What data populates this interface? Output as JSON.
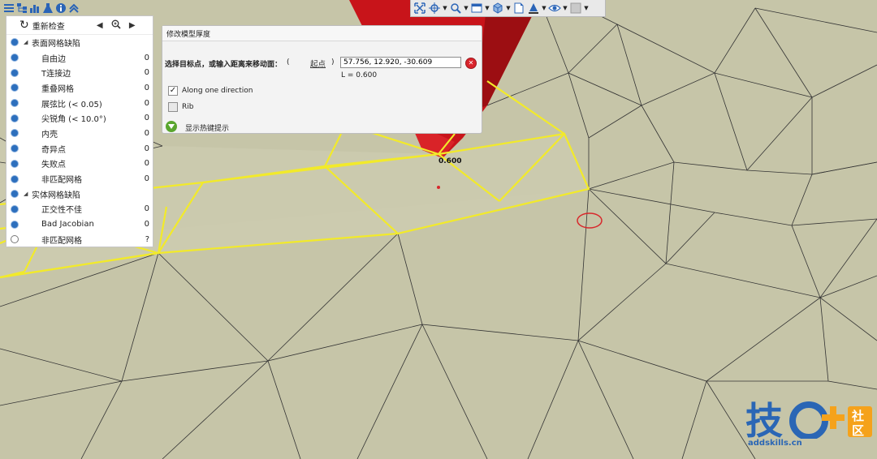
{
  "left_toolbar": {
    "icons": [
      "tree-icon",
      "hierarchy-icon",
      "chart-icon",
      "flask-icon",
      "info-icon",
      "collapse-icon"
    ]
  },
  "right_toolbar": {
    "icons": [
      "fit-view-icon",
      "pick-point-icon",
      "zoom-icon",
      "window-icon",
      "cube-view-icon",
      "page-icon",
      "fill-icon",
      "eye-icon",
      "display-icon"
    ]
  },
  "panel": {
    "recheck_label": "重新检查",
    "surface_category": "表面网格缺陷",
    "surface_items": [
      {
        "label": "自由边",
        "count": "0"
      },
      {
        "label": "T连接边",
        "count": "0"
      },
      {
        "label": "重叠网格",
        "count": "0"
      },
      {
        "label": "展弦比 (< 0.05)",
        "count": "0"
      },
      {
        "label": "尖锐角 (< 10.0°)",
        "count": "0"
      },
      {
        "label": "内壳",
        "count": "0"
      },
      {
        "label": "奇异点",
        "count": "0"
      },
      {
        "label": "失败点",
        "count": "0"
      },
      {
        "label": "非匹配网格",
        "count": "0"
      }
    ],
    "solid_category": "实体网格缺陷",
    "solid_items": [
      {
        "label": "正交性不佳",
        "count": "0"
      },
      {
        "label": "Bad Jacobian",
        "count": "0"
      },
      {
        "label": "非匹配网格",
        "count": "?"
      }
    ]
  },
  "dialog": {
    "title": "修改模型厚度",
    "prompt": "选择目标点，或输入距离来移动面：",
    "paren_open": "(",
    "paren_close": ")",
    "start_point_label": "起点",
    "coord_value": "57.756, 12.920, -30.609",
    "length_text": "L = 0.600",
    "along_one_direction_label": "Along one direction",
    "along_one_direction_checked": true,
    "rib_label": "Rib",
    "rib_checked": false,
    "hotkey_hint_label": "显示热键提示"
  },
  "viewport": {
    "dimension_label": "0.600"
  },
  "logo": {
    "char_ji": "技",
    "char_she": "社",
    "char_qu": "区",
    "url": "addskills.cn"
  },
  "colors": {
    "mesh_bg": "#c6c5a8",
    "selected_edge": "#f2ea2a",
    "red_part": "#c8141a",
    "accent_blue": "#2d6fbd"
  }
}
